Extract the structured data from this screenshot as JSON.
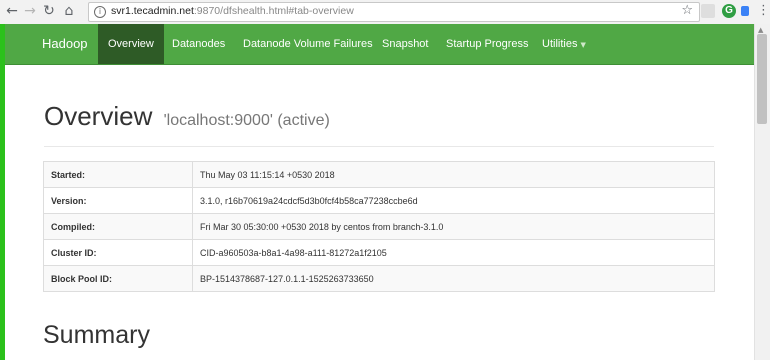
{
  "browser": {
    "url_host": "svr1.tecadmin.net",
    "url_rest": ":9870/dfshealth.html#tab-overview"
  },
  "navbar": {
    "brand": "Hadoop",
    "items": [
      {
        "label": "Overview",
        "active": true
      },
      {
        "label": "Datanodes",
        "active": false
      },
      {
        "label": "Datanode Volume Failures",
        "active": false
      },
      {
        "label": "Snapshot",
        "active": false
      },
      {
        "label": "Startup Progress",
        "active": false
      },
      {
        "label": "Utilities",
        "active": false
      }
    ]
  },
  "overview": {
    "title": "Overview",
    "subtitle": "'localhost:9000' (active)",
    "rows": [
      {
        "key": "Started:",
        "value": "Thu May 03 11:15:14 +0530 2018"
      },
      {
        "key": "Version:",
        "value": "3.1.0, r16b70619a24cdcf5d3b0fcf4b58ca77238ccbe6d"
      },
      {
        "key": "Compiled:",
        "value": "Fri Mar 30 05:30:00 +0530 2018 by centos from branch-3.1.0"
      },
      {
        "key": "Cluster ID:",
        "value": "CID-a960503a-b8a1-4a98-a111-81272a1f2105"
      },
      {
        "key": "Block Pool ID:",
        "value": "BP-1514378687-127.0.1.1-1525263733650"
      }
    ]
  },
  "summary": {
    "title": "Summary"
  },
  "colors": {
    "navbar": "#50a845",
    "active_tab": "#2e5b26",
    "frame_border": "#2bc11b"
  }
}
